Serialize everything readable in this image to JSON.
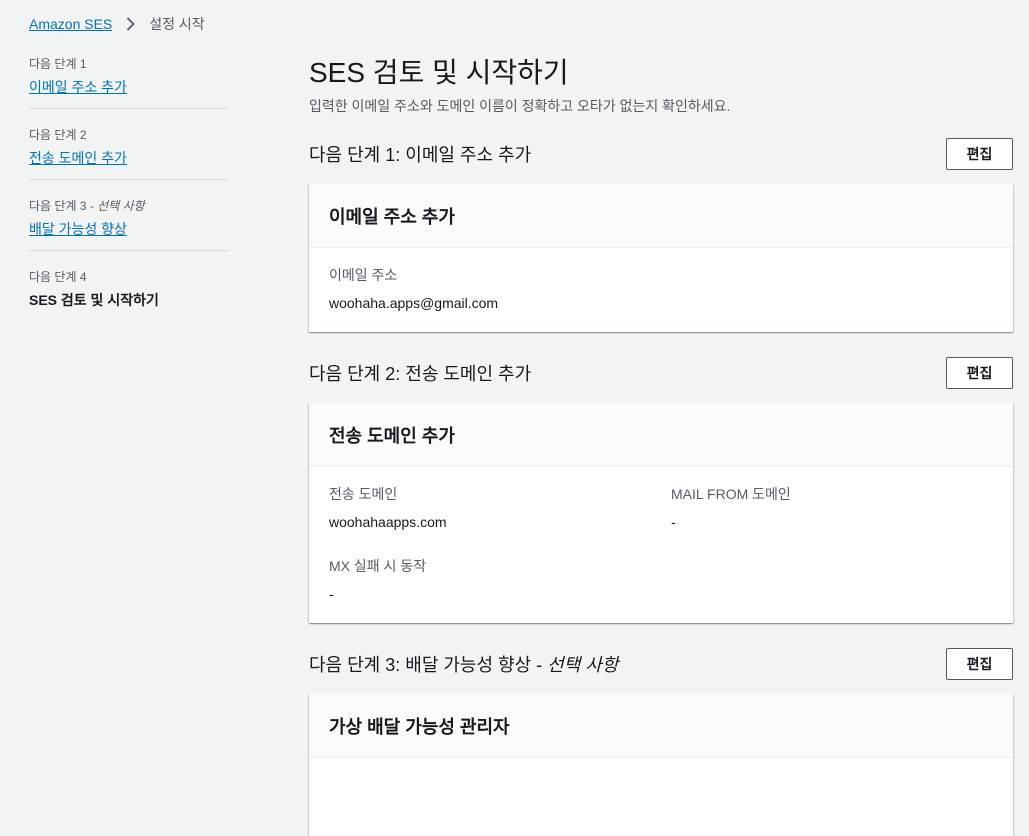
{
  "breadcrumb": {
    "root": "Amazon SES",
    "current": "설정 시작"
  },
  "steps": [
    {
      "label": "다음 단계 1",
      "optional": "",
      "title": "이메일 주소 추가"
    },
    {
      "label": "다음 단계 2",
      "optional": "",
      "title": "전송 도메인 추가"
    },
    {
      "label": "다음 단계 3 - ",
      "optional": "선택 사항",
      "title": "배달 가능성 향상"
    },
    {
      "label": "다음 단계 4",
      "optional": "",
      "title": "SES 검토 및 시작하기"
    }
  ],
  "page": {
    "title": "SES 검토 및 시작하기",
    "description": "입력한 이메일 주소와 도메인 이름이 정확하고 오타가 없는지 확인하세요."
  },
  "edit_label": "편집",
  "sections": [
    {
      "title": "다음 단계 1: 이메일 주소 추가",
      "title_optional": "",
      "card_title": "이메일 주소 추가",
      "fields": [
        {
          "label": "이메일 주소",
          "value": "woohaha.apps@gmail.com"
        }
      ]
    },
    {
      "title": "다음 단계 2: 전송 도메인 추가",
      "title_optional": "",
      "card_title": "전송 도메인 추가",
      "fields": [
        {
          "label": "전송 도메인",
          "value": "woohahaapps.com"
        },
        {
          "label": "MAIL FROM 도메인",
          "value": "-"
        },
        {
          "label": "MX 실패 시 동작",
          "value": "-"
        }
      ]
    },
    {
      "title": "다음 단계 3: 배달 가능성 향상 - ",
      "title_optional": "선택 사항",
      "card_title": "가상 배달 가능성 관리자"
    }
  ],
  "colors": {
    "link": "#0073bb",
    "background": "#f2f3f3",
    "text": "#16191f",
    "muted": "#545b64"
  },
  "icons": {
    "breadcrumb_separator": "chevron-right-icon"
  }
}
